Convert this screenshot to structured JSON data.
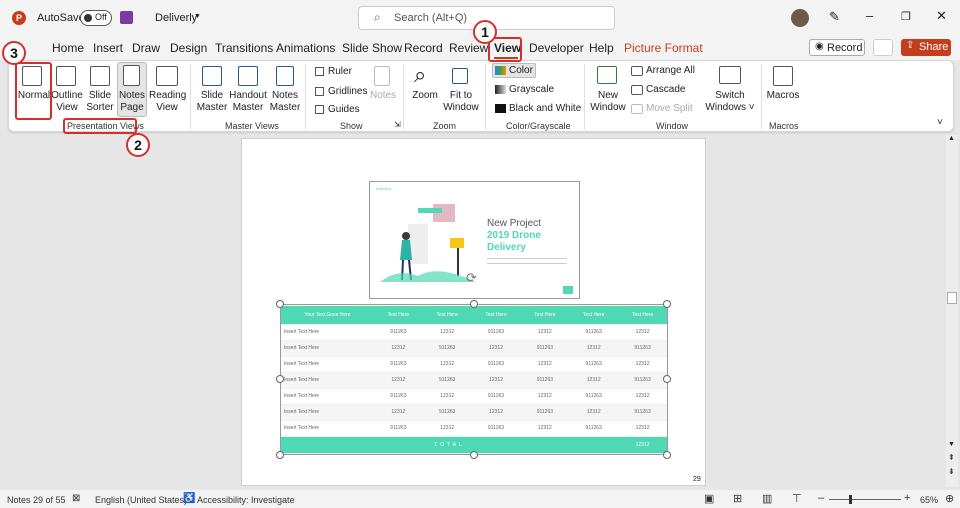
{
  "titlebar": {
    "autosave": "AutoSave",
    "toggle": "Off",
    "doc": "Deliverly",
    "search": "Search (Alt+Q)"
  },
  "tabs": [
    "Home",
    "Insert",
    "Draw",
    "Design",
    "Transitions",
    "Animations",
    "Slide Show",
    "Record",
    "Review",
    "View",
    "Developer",
    "Help",
    "Picture Format"
  ],
  "record_btn": "Record",
  "share_btn": "Share",
  "ribbon": {
    "presentation_views": [
      "Normal",
      "Outline\nView",
      "Slide\nSorter",
      "Notes\nPage",
      "Reading\nView"
    ],
    "master_views": [
      "Slide\nMaster",
      "Handout\nMaster",
      "Notes\nMaster"
    ],
    "show": [
      "Ruler",
      "Gridlines",
      "Guides"
    ],
    "notes": "Notes",
    "zoom": [
      "Zoom",
      "Fit to\nWindow"
    ],
    "color": [
      "Color",
      "Grayscale",
      "Black and White"
    ],
    "window": {
      "new": "New\nWindow",
      "arrange": "Arrange All",
      "cascade": "Cascade",
      "move": "Move Split",
      "switch": "Switch\nWindows ˅"
    },
    "macros": "Macros",
    "groups": [
      "Presentation Views",
      "Master Views",
      "Show",
      "Zoom",
      "Color/Grayscale",
      "Window",
      "Macros"
    ]
  },
  "callouts": [
    "1",
    "2",
    "3"
  ],
  "slide": {
    "logo": "Deliverly",
    "title1": "New Project",
    "title2": "2019 Drone",
    "title3": "Delivery"
  },
  "table": {
    "header": [
      "Your Text Goes Here",
      "Text Here",
      "Text Here",
      "Text Here",
      "Text Here",
      "Text Here",
      "Text Here"
    ],
    "rows": [
      [
        "Insert Text Here",
        "911263",
        "12312",
        "911263",
        "12312",
        "911263",
        "12312"
      ],
      [
        "Insert Text Here",
        "12312",
        "911263",
        "12312",
        "911263",
        "12312",
        "911263"
      ],
      [
        "Insert Text Here",
        "911263",
        "12312",
        "911263",
        "12312",
        "911263",
        "12312"
      ],
      [
        "Insert Text Here",
        "12312",
        "911263",
        "12312",
        "911263",
        "12312",
        "911263"
      ],
      [
        "Insert Text Here",
        "911263",
        "12312",
        "911263",
        "12312",
        "911263",
        "12312"
      ],
      [
        "Insert Text Here",
        "12312",
        "911263",
        "12312",
        "911263",
        "12312",
        "911263"
      ],
      [
        "Insert Text Here",
        "911263",
        "12312",
        "911263",
        "12312",
        "911263",
        "12312"
      ]
    ],
    "total": "TOTAL",
    "total_value": "12312"
  },
  "page_number": "29",
  "status": {
    "notes": "Notes 29 of 55",
    "lang": "English (United States)",
    "access": "Accessibility: Investigate",
    "zoom": "65%"
  },
  "colors": {
    "accent": "#c43e1c",
    "teal": "#4fd8b4",
    "red": "#d32f2f"
  }
}
